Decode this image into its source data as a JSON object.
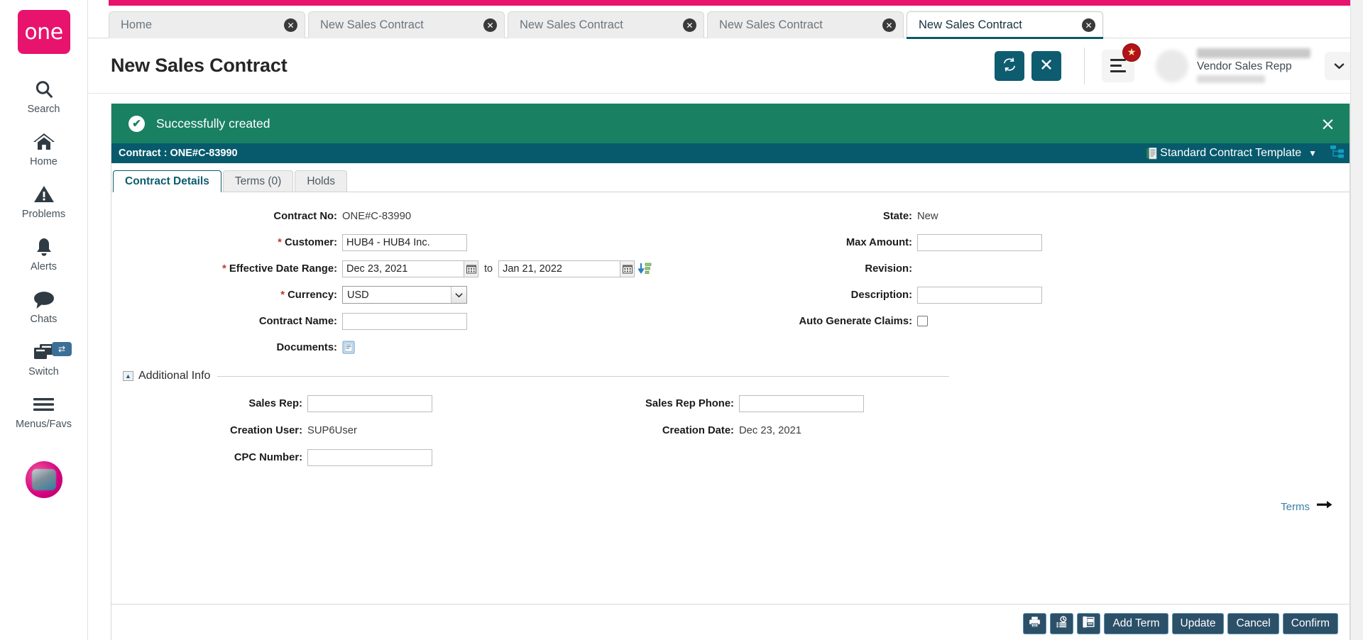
{
  "sidebar": {
    "logo_text": "one",
    "items": [
      {
        "label": "Search",
        "icon": "search-icon"
      },
      {
        "label": "Home",
        "icon": "home-icon"
      },
      {
        "label": "Problems",
        "icon": "warning-triangle-icon"
      },
      {
        "label": "Alerts",
        "icon": "bell-icon"
      },
      {
        "label": "Chats",
        "icon": "chat-bubble-icon"
      },
      {
        "label": "Switch",
        "icon": "windows-switch-icon",
        "badge": "⇄"
      },
      {
        "label": "Menus/Favs",
        "icon": "hamburger-icon"
      }
    ]
  },
  "tabs": [
    {
      "label": "Home",
      "active": false
    },
    {
      "label": "New Sales Contract",
      "active": false
    },
    {
      "label": "New Sales Contract",
      "active": false
    },
    {
      "label": "New Sales Contract",
      "active": false
    },
    {
      "label": "New Sales Contract",
      "active": true
    }
  ],
  "header": {
    "title": "New Sales Contract",
    "refresh_icon": "refresh-icon",
    "close_icon": "close-icon",
    "menu_icon": "hamburger-menu-icon",
    "star_badge": "★",
    "user_role": "Vendor Sales Repp",
    "caret": "∨"
  },
  "banner": {
    "message": "Successfully created",
    "check": "✔",
    "close": "×"
  },
  "contract_bar": {
    "title": "Contract : ONE#C-83990",
    "template_label": "Standard Contract Template",
    "template_caret": "▼"
  },
  "inner_tabs": [
    {
      "label": "Contract Details",
      "active": true
    },
    {
      "label": "Terms (0)",
      "active": false
    },
    {
      "label": "Holds",
      "active": false
    }
  ],
  "form": {
    "contract_no_label": "Contract No:",
    "contract_no_value": "ONE#C-83990",
    "customer_label": "Customer:",
    "customer_value": "HUB4 - HUB4 Inc.",
    "effective_label": "Effective Date Range:",
    "effective_from": "Dec 23, 2021",
    "effective_to": "Jan 21, 2022",
    "to_word": "to",
    "currency_label": "Currency:",
    "currency_value": "USD",
    "currency_options": [
      "USD"
    ],
    "contract_name_label": "Contract Name:",
    "contract_name_value": "",
    "documents_label": "Documents:",
    "state_label": "State:",
    "state_value": "New",
    "max_amount_label": "Max Amount:",
    "max_amount_value": "",
    "revision_label": "Revision:",
    "revision_value": "",
    "description_label": "Description:",
    "description_value": "",
    "auto_claims_label": "Auto Generate Claims:",
    "auto_claims_checked": false,
    "required_marker": "*"
  },
  "additional_info": {
    "title": "Additional Info",
    "collapse_glyph": "▲",
    "sales_rep_label": "Sales Rep:",
    "sales_rep_value": "",
    "sales_rep_phone_label": "Sales Rep Phone:",
    "sales_rep_phone_value": "",
    "creation_user_label": "Creation User:",
    "creation_user_value": "SUP6User",
    "creation_date_label": "Creation Date:",
    "creation_date_value": "Dec 23, 2021",
    "cpc_number_label": "CPC Number:",
    "cpc_number_value": ""
  },
  "terms_link": {
    "label": "Terms",
    "arrow": "➡"
  },
  "footer": {
    "print_icon": "printer-icon",
    "history_icon": "history-icon",
    "copy_icon": "copy-icon",
    "add_term_label": "Add Term",
    "update_label": "Update",
    "cancel_label": "Cancel",
    "confirm_label": "Confirm"
  },
  "colors": {
    "brand_pink": "#e8136c",
    "teal": "#0d5c70",
    "success_green": "#1a8062",
    "contract_bar": "#075a6c",
    "footer_button": "#2c5068"
  }
}
